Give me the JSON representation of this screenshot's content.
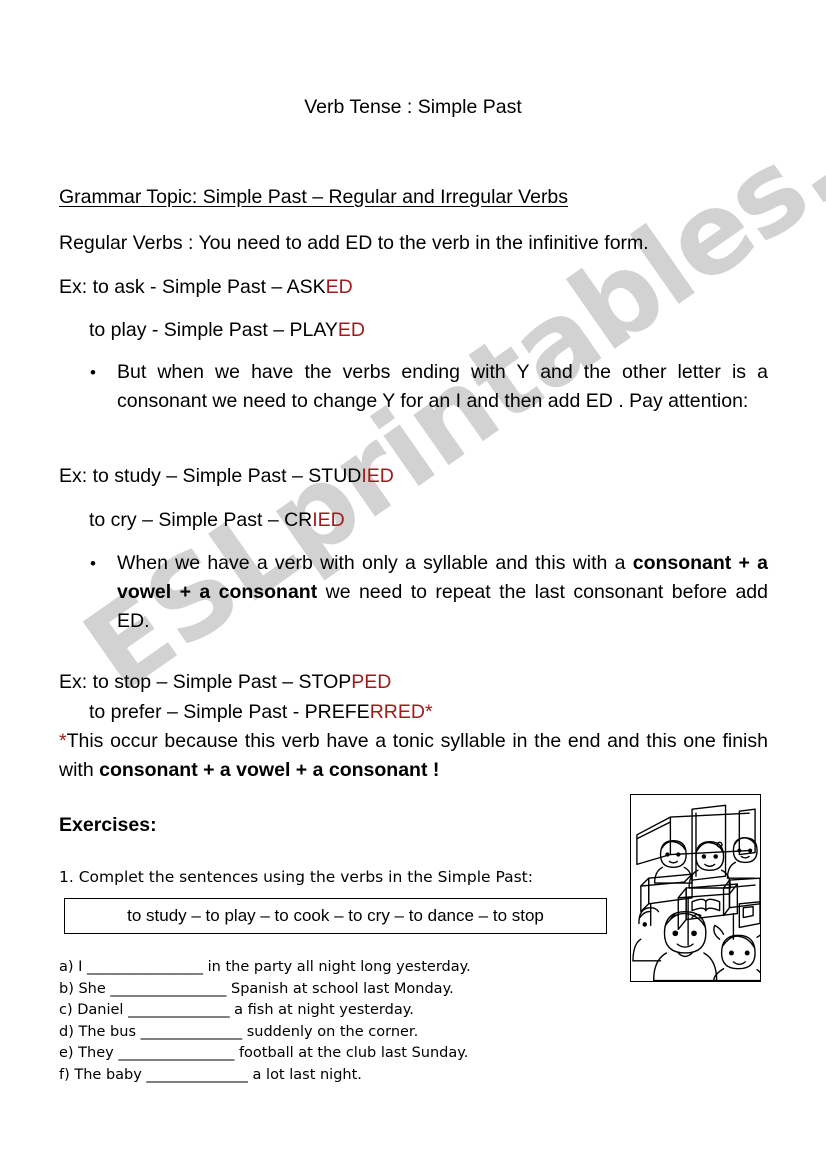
{
  "document": {
    "title": "Verb Tense : Simple Past",
    "heading": "Grammar Topic: Simple Past – Regular and Irregular Verbs"
  },
  "watermark": {
    "text": "ESLprintables.com",
    "color": "#d2d2d2"
  },
  "colors": {
    "accent_red": "#9e1b1b",
    "text": "#000000",
    "page_background": "#ffffff"
  },
  "lesson": {
    "regular_verbs_rule": "Regular Verbs : You need to add ED to the verb in the infinitive form.",
    "example_1": {
      "line_a_plain": "Ex: to ask -  Simple Past – ASK",
      "line_a_red": "ED",
      "line_b_plain": "to play -  Simple Past – PLAY",
      "line_b_red": "ED"
    },
    "bullet_1": {
      "text_head": "But when we have the verbs ending with Y and the other letter is a consonant we need to change Y for an I and then add ED .",
      "text_tail": "Pay attention:"
    },
    "example_2": {
      "line_a_plain": "Ex: to study – Simple Past – STUD",
      "line_a_red": "IED",
      "line_b_plain": "to cry – Simple Past – CR",
      "line_b_red": "IED"
    },
    "bullet_2": {
      "text_head_1": "When we have a verb with only a syllable and this with a ",
      "text_bold": "consonant + a vowel + a consonant",
      "text_head_2": "  we need to repeat the last",
      "text_tail": "consonant before add ED."
    },
    "example_3": {
      "line_a_plain": "Ex: to stop – Simple Past – STOP",
      "line_a_red": "PED",
      "line_b_plain": "to prefer – Simple Past  - PREFE",
      "line_b_red": "RRED*"
    },
    "footnote": {
      "asterisk": "*",
      "text_head": "This occur because this verb have a tonic syllable in the end and this",
      "text_tail_1": "one finish with ",
      "text_bold": "consonant + a vowel + a consonant",
      "text_tail_2": " !"
    }
  },
  "exercises": {
    "title": "Exercises:",
    "instruction": "1. Complet the sentences using the verbs in the Simple Past:",
    "verb_bank": "to  study –  to play  –  to cook  –  to cry –  to dance –  to stop",
    "verb_bank_items": [
      "to  study",
      "to play",
      "to cook",
      "to cry",
      "to dance",
      "to stop"
    ],
    "sentences": [
      "a) I ________________ in the party all night long yesterday.",
      "b) She ________________ Spanish at school last Monday.",
      "c) Daniel ______________ a fish at night yesterday.",
      "d) The bus ______________ suddenly on the corner.",
      "e) They ________________ football at the club last Sunday.",
      "f) The baby ______________ a lot last night."
    ]
  },
  "illustration": {
    "name": "classroom-children-line-drawing",
    "description": "Black and white line drawing of children sitting at desks in a classroom"
  }
}
